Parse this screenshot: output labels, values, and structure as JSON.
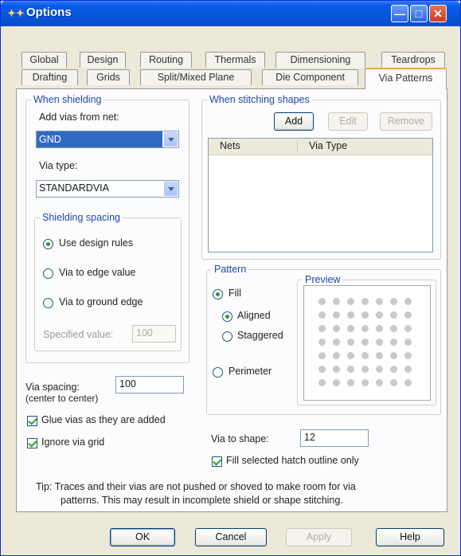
{
  "window": {
    "title": "Options",
    "app_icon": "options-icon"
  },
  "tabs_row1": [
    "Global",
    "Design",
    "Routing",
    "Thermals",
    "Dimensioning",
    "Teardrops"
  ],
  "tabs_row2": [
    "Drafting",
    "Grids",
    "Split/Mixed Plane",
    "Die Component",
    "Via Patterns"
  ],
  "selected_tab": "Via Patterns",
  "shielding": {
    "legend": "When shielding",
    "add_vias_label": "Add vias from net:",
    "net_value": "GND",
    "via_type_label": "Via type:",
    "via_type_value": "STANDARDVIA",
    "spacing_legend": "Shielding spacing",
    "options": [
      "Use design rules",
      "Via to edge value",
      "Via to ground edge"
    ],
    "selected_option": "Use design rules",
    "specified_label": "Specified value:",
    "specified_value": "100"
  },
  "via_spacing": {
    "label": "Via spacing:",
    "sublabel": "(center to center)",
    "value": "100"
  },
  "glue_vias": {
    "label": "Glue vias as they are added",
    "checked": true
  },
  "ignore_grid": {
    "label": "Ignore via grid",
    "checked": true
  },
  "stitching": {
    "legend": "When stitching shapes",
    "add_label": "Add",
    "edit_label": "Edit",
    "remove_label": "Remove",
    "columns": [
      "Nets",
      "Via Type"
    ]
  },
  "pattern": {
    "legend": "Pattern",
    "fill_label": "Fill",
    "aligned_label": "Aligned",
    "staggered_label": "Staggered",
    "perimeter_label": "Perimeter",
    "selected": "Fill",
    "fill_style": "Aligned",
    "preview_label": "Preview"
  },
  "via_to_shape": {
    "label": "Via to shape:",
    "value": "12"
  },
  "fill_hatch": {
    "label": "Fill selected hatch outline only",
    "checked": true
  },
  "tip": {
    "line1": "Tip:  Traces and their vias are not pushed or shoved to make room for via",
    "line2": "patterns. This may result in incomplete shield or shape stitching."
  },
  "buttons": {
    "ok": "OK",
    "cancel": "Cancel",
    "apply": "Apply",
    "help": "Help"
  },
  "colors": {
    "title_bar": "#0a5ce8",
    "legend_text": "#1c49a8",
    "selected_tab_accent": "#f0a838",
    "radio_dot": "#2e9a2e"
  }
}
